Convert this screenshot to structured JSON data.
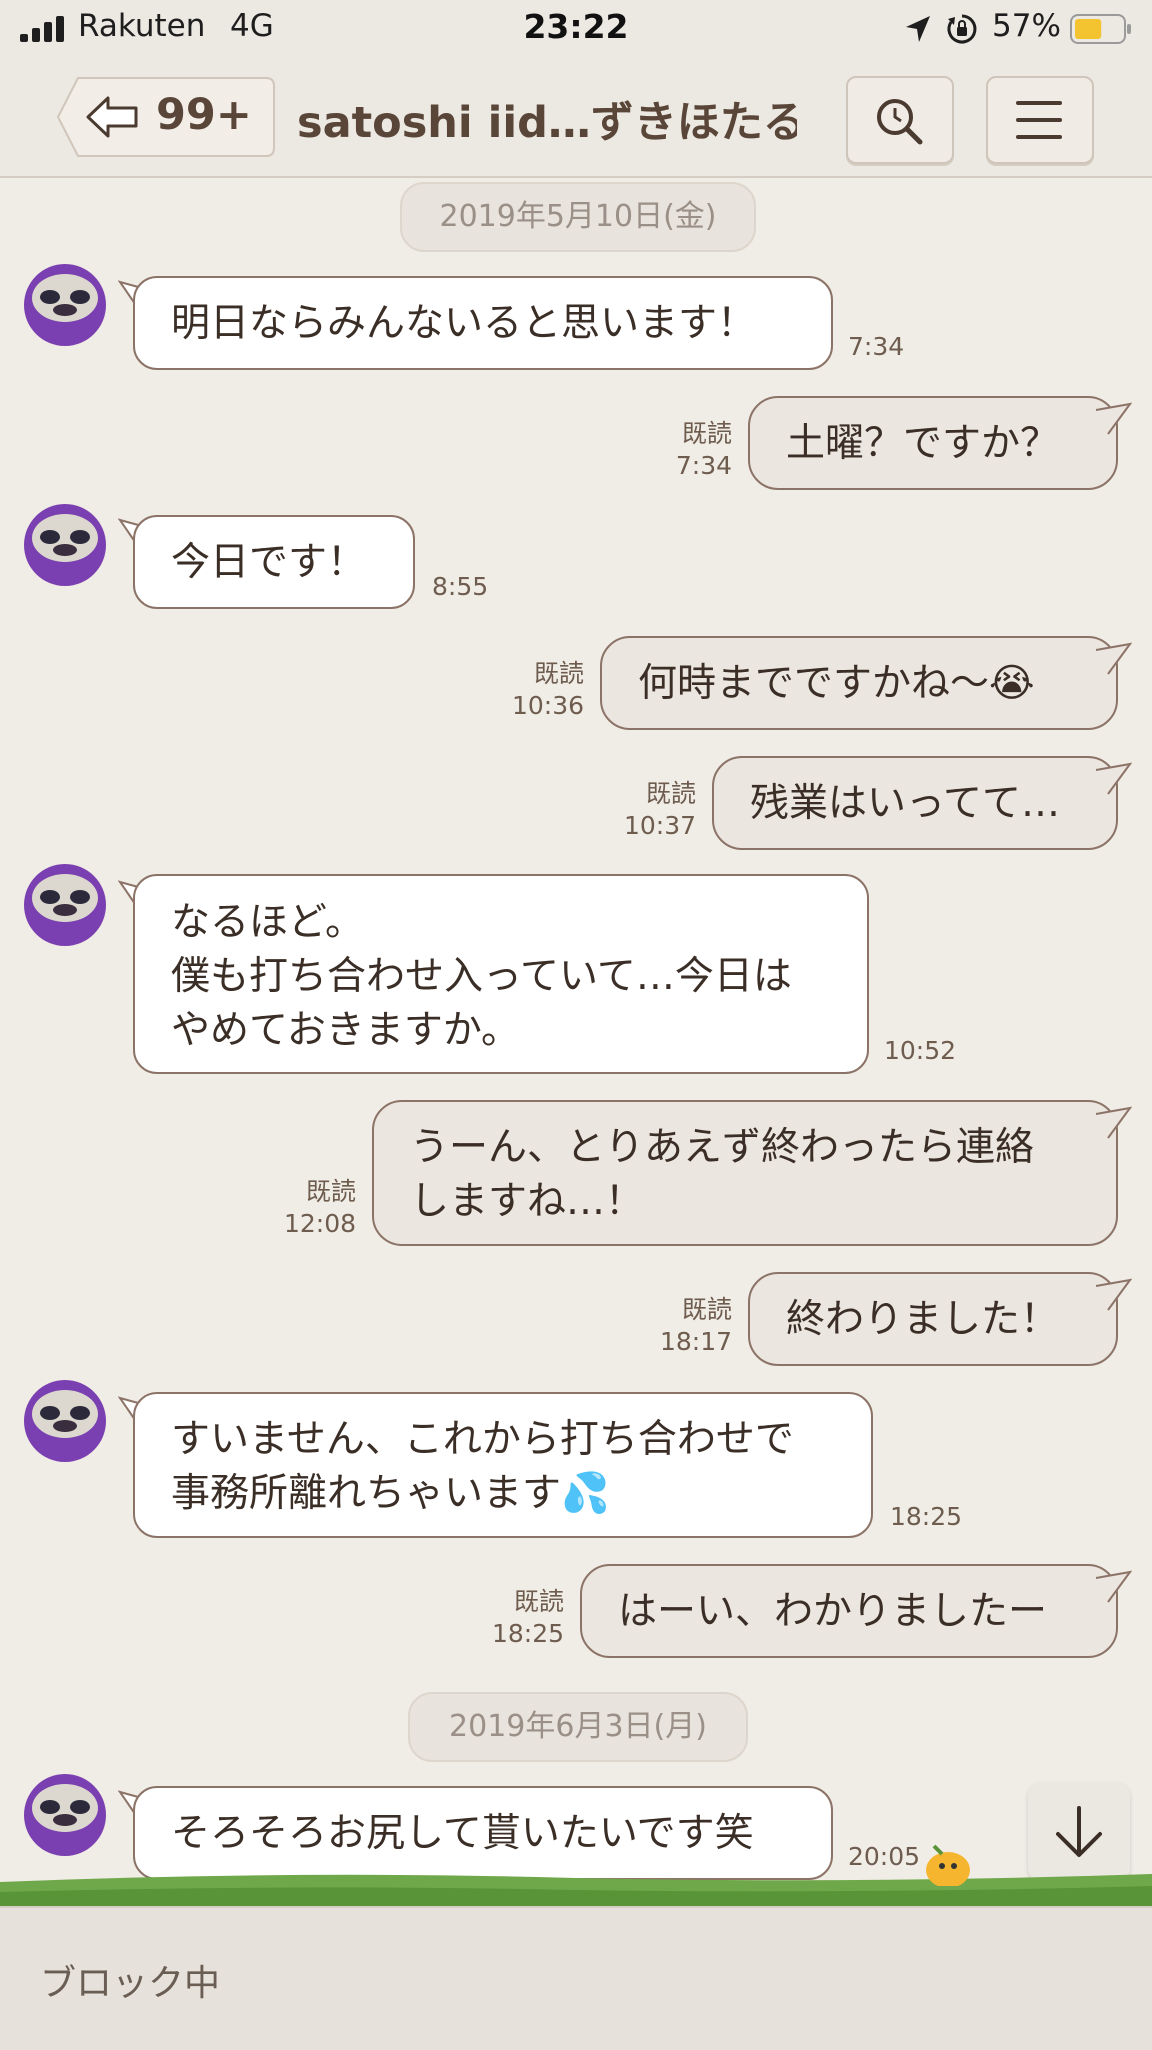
{
  "status_bar": {
    "carrier": "Rakuten",
    "network": "4G",
    "time": "23:22",
    "battery": "57%",
    "battery_level": 0.57,
    "icons": [
      "signal-icon",
      "location-icon",
      "orientation-lock-icon",
      "battery-icon"
    ]
  },
  "header": {
    "back_label": "99+",
    "title": "satoshi iid…ずきほたる)",
    "icons": [
      "back-arrow-icon",
      "search-icon",
      "menu-icon"
    ]
  },
  "date_separators": [
    "2019年5月10日(金)",
    "2019年6月3日(月)"
  ],
  "messages": [
    {
      "direction": "in",
      "lines": [
        "明日ならみんないると思います！"
      ],
      "time": "7:34"
    },
    {
      "direction": "out",
      "lines": [
        "土曜？ですか？"
      ],
      "read": "既読",
      "time": "7:34"
    },
    {
      "direction": "in",
      "lines": [
        "今日です！"
      ],
      "time": "8:55"
    },
    {
      "direction": "out",
      "lines": [
        "何時までですかね〜😭"
      ],
      "read": "既読",
      "time": "10:36"
    },
    {
      "direction": "out",
      "lines": [
        "残業はいってて…"
      ],
      "read": "既読",
      "time": "10:37"
    },
    {
      "direction": "in",
      "lines": [
        "なるほど。",
        "僕も打ち合わせ入っていて…今日は",
        "やめておきますか。"
      ],
      "time": "10:52"
    },
    {
      "direction": "out",
      "lines": [
        "うーん、とりあえず終わったら連絡",
        "しますね…！"
      ],
      "read": "既読",
      "time": "12:08"
    },
    {
      "direction": "out",
      "lines": [
        "終わりました！"
      ],
      "read": "既読",
      "time": "18:17"
    },
    {
      "direction": "in",
      "lines": [
        "すいません、これから打ち合わせで",
        "事務所離れちゃいます💦"
      ],
      "time": "18:25"
    },
    {
      "direction": "out",
      "lines": [
        "はーい、わかりましたー"
      ],
      "read": "既読",
      "time": "18:25"
    },
    {
      "direction": "in",
      "lines": [
        "そろそろお尻して貰いたいです笑"
      ],
      "time": "20:05"
    }
  ],
  "footer": {
    "status": "ブロック中"
  },
  "colors": {
    "background": "#f0ece6",
    "bubble_out": "#ebe6df",
    "bubble_in": "#ffffff",
    "bubble_border": "#8c7367",
    "avatar": "#7a3fb0",
    "text_brown": "#5a4638"
  }
}
